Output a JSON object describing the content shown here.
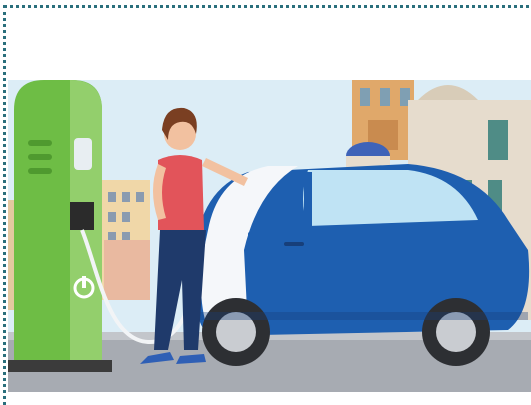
{
  "illustration": {
    "subject": "woman-charging-electric-car",
    "icons": [
      "charging-station-icon",
      "power-icon",
      "electric-car-icon",
      "woman-icon",
      "cityscape-icon",
      "cathedral-icon"
    ],
    "colors": {
      "frame": "#2a6f7c",
      "sky": "#dcedf6",
      "charger": "#6ebd45",
      "car_body": "#1e5fb0",
      "car_white": "#f5f7fa",
      "shirt": "#e2545a",
      "pants": "#1f3a6b",
      "building": "#e8d9b9",
      "ground": "#a7abb2"
    }
  }
}
